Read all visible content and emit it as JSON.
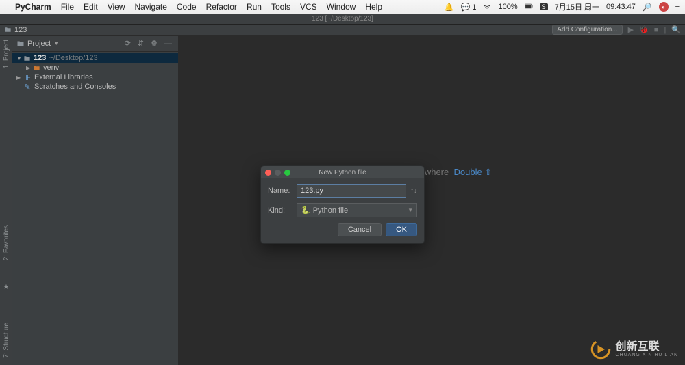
{
  "menubar": {
    "app": "PyCharm",
    "items": [
      "File",
      "Edit",
      "View",
      "Navigate",
      "Code",
      "Refactor",
      "Run",
      "Tools",
      "VCS",
      "Window",
      "Help"
    ],
    "wechat_badge": "1",
    "battery": "100%",
    "date": "7月15日 周一",
    "time": "09:43:47"
  },
  "titlebar": {
    "text": "123 [~/Desktop/123]"
  },
  "toolbar": {
    "crumb": "123",
    "addconf": "Add Configuration..."
  },
  "sidebar": {
    "title": "Project",
    "tree": {
      "root": {
        "name": "123",
        "path": "~/Desktop/123"
      },
      "venv": "venv",
      "extlib": "External Libraries",
      "scratches": "Scratches and Consoles"
    }
  },
  "gutter": {
    "project": "1: Project",
    "favorites": "2: Favorites",
    "structure": "7: Structure"
  },
  "hint": {
    "prefix": "Search Everywhere",
    "key": "Double ⇧"
  },
  "dialog": {
    "title": "New Python file",
    "name_label": "Name:",
    "name_value": "123.py",
    "kind_label": "Kind:",
    "kind_value": "Python file",
    "cancel": "Cancel",
    "ok": "OK"
  },
  "watermark": {
    "main": "创新互联",
    "sub": "CHUANG XIN HU LIAN"
  }
}
